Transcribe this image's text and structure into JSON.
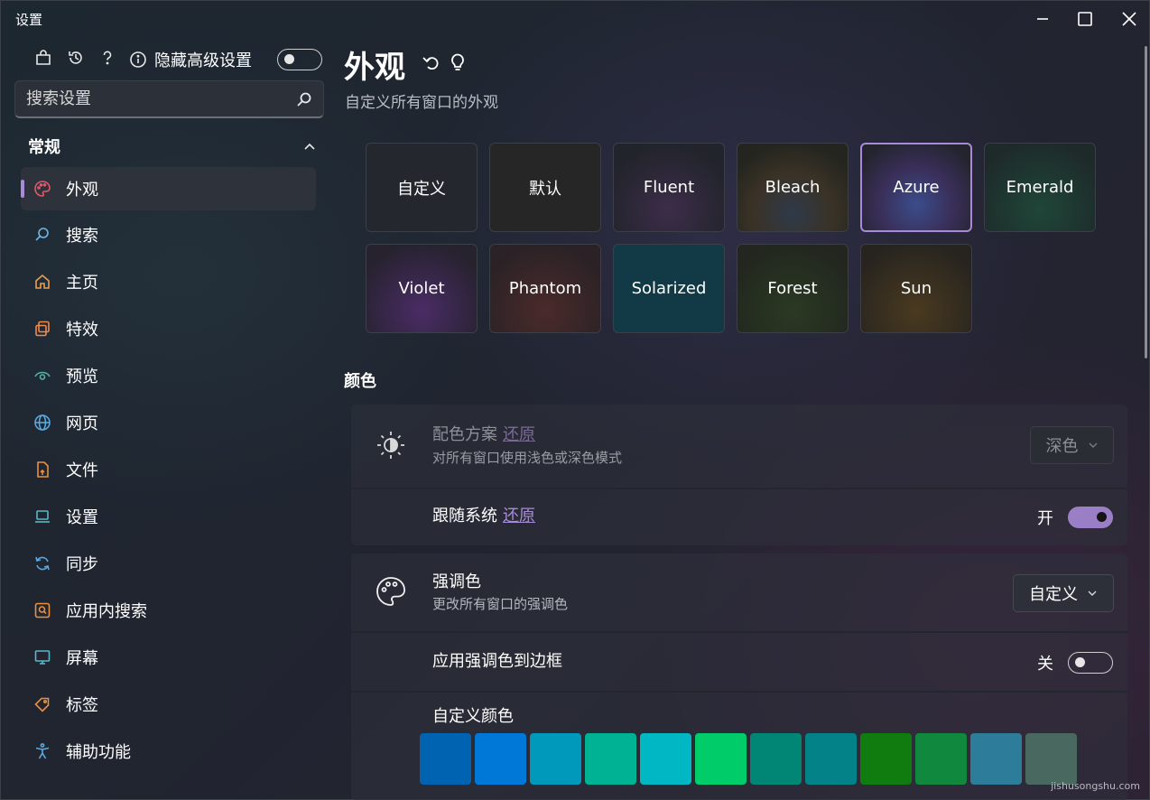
{
  "titlebar": {
    "title": "设置",
    "minimize": "minimize-icon",
    "maximize": "maximize-icon",
    "close": "close-icon"
  },
  "sidebar": {
    "toolbar_icons": [
      "store-icon",
      "history-icon",
      "help-icon"
    ],
    "hide_advanced": {
      "label": "隐藏高级设置",
      "on": false
    },
    "search": {
      "placeholder": "搜索设置"
    },
    "section": {
      "title": "常规",
      "expanded": true
    },
    "items": [
      {
        "label": "外观",
        "icon": "palette-icon",
        "active": true
      },
      {
        "label": "搜索",
        "icon": "search-icon"
      },
      {
        "label": "主页",
        "icon": "home-icon"
      },
      {
        "label": "特效",
        "icon": "effects-icon"
      },
      {
        "label": "预览",
        "icon": "eye-icon"
      },
      {
        "label": "网页",
        "icon": "globe-icon"
      },
      {
        "label": "文件",
        "icon": "file-icon"
      },
      {
        "label": "设置",
        "icon": "laptop-icon"
      },
      {
        "label": "同步",
        "icon": "sync-icon"
      },
      {
        "label": "应用内搜索",
        "icon": "in-app-search-icon"
      },
      {
        "label": "屏幕",
        "icon": "monitor-icon"
      },
      {
        "label": "标签",
        "icon": "tag-icon"
      },
      {
        "label": "辅助功能",
        "icon": "accessibility-icon"
      }
    ]
  },
  "main": {
    "title": "外观",
    "subtitle": "自定义所有窗口的外观",
    "header_icons": [
      "undo-icon",
      "lightbulb-icon"
    ],
    "themes": [
      {
        "label": "自定义",
        "glow": "#2c2f36"
      },
      {
        "label": "默认",
        "glow": "#2a2a2a"
      },
      {
        "label": "Fluent",
        "glow": "#3d2d4a"
      },
      {
        "label": "Bleach",
        "glow": "#3a3226"
      },
      {
        "label": "Azure",
        "glow": "#3a4d8a",
        "selected": true
      },
      {
        "label": "Emerald",
        "glow": "#1f4638"
      },
      {
        "label": "Violet",
        "glow": "#4a2c66"
      },
      {
        "label": "Phantom",
        "glow": "#4a2a2a"
      },
      {
        "label": "Solarized",
        "glow": "#0e3a45",
        "solid": "#113a46"
      },
      {
        "label": "Forest",
        "glow": "#2a3a22"
      },
      {
        "label": "Sun",
        "glow": "#4a3a20"
      }
    ],
    "colors_heading": "颜色",
    "scheme": {
      "title": "配色方案",
      "reset": "还原",
      "desc": "对所有窗口使用浅色或深色模式",
      "value": "深色",
      "icon": "brightness-icon"
    },
    "follow_system": {
      "title": "跟随系统",
      "reset": "还原",
      "state": "开",
      "on": true
    },
    "accent": {
      "title": "强调色",
      "desc": "更改所有窗口的强调色",
      "value": "自定义",
      "icon": "palette-icon"
    },
    "accent_border": {
      "title": "应用强调色到边框",
      "state": "关",
      "on": false
    },
    "custom_colors": {
      "title": "自定义颜色",
      "swatches": [
        "#0063b1",
        "#0078d7",
        "#0099bc",
        "#00b294",
        "#00b7c3",
        "#00cc6a",
        "#018574",
        "#038387",
        "#107c10",
        "#10893e",
        "#2d7d9a",
        "#486860"
      ]
    }
  },
  "accent_color": "#a88bd6",
  "watermark": "jishusongshu.com"
}
